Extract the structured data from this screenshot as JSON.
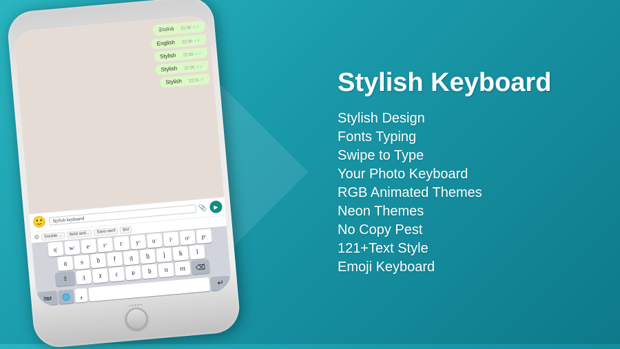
{
  "app": {
    "title": "Stylish Keyboard",
    "background_gradient_start": "#2ab5c0",
    "background_gradient_end": "#0d7a8a"
  },
  "features": [
    {
      "id": "stylish-design",
      "label": "Stylish Design"
    },
    {
      "id": "fonts-typing",
      "label": "Fonts Typing"
    },
    {
      "id": "swipe-to-type",
      "label": "Swipe to Type"
    },
    {
      "id": "photo-keyboard",
      "label": "Your Photo Keyboard"
    },
    {
      "id": "rgb-themes",
      "label": "RGB Animated Themes"
    },
    {
      "id": "neon-themes",
      "label": "Neon Themes"
    },
    {
      "id": "no-copy-pest",
      "label": "No Copy Pest"
    },
    {
      "id": "text-style",
      "label": "121+Text Style"
    },
    {
      "id": "emoji-keyboard",
      "label": "Emoji Keyboard"
    }
  ],
  "phone": {
    "chat_bubbles": [
      {
        "text": "𝔖𝔱𝔶𝔩𝔦𝔰𝔥",
        "time": "22:30",
        "ticks": "✓✓"
      },
      {
        "text": "English",
        "time": "22:30",
        "ticks": "✓✓"
      },
      {
        "text": "Stylish",
        "time": "22:30",
        "ticks": "✓✓"
      },
      {
        "text": "Stylish",
        "time": "22:30",
        "ticks": "✓✓"
      },
      {
        "text": "Stylish",
        "time": "22:31",
        "ticks": "✓"
      }
    ],
    "input_placeholder": "Stylish keyboard",
    "font_options": [
      "Double...",
      "Bold and...",
      "Sans-serif",
      "Bol"
    ],
    "keyboard_rows": [
      [
        "q",
        "w",
        "e",
        "r",
        "t",
        "y",
        "u",
        "i",
        "o",
        "p"
      ],
      [
        "a",
        "s",
        "d",
        "f",
        "g",
        "h",
        "j",
        "k",
        "l"
      ],
      [
        "z",
        "x",
        "c",
        "v",
        "b",
        "n",
        "m"
      ]
    ]
  }
}
